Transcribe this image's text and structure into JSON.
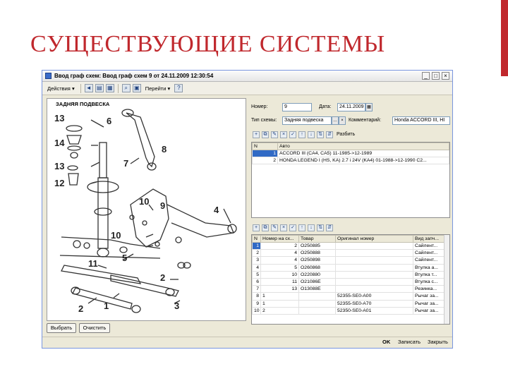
{
  "slide": {
    "title": "СУЩЕСТВУЮЩИЕ СИСТЕМЫ",
    "accent_color": "#c0282d"
  },
  "window": {
    "title": "Ввод граф схем: Ввод граф схем 9 от 24.11.2009 12:30:54",
    "toolbar": {
      "actions_menu": "Действия ▾",
      "goto_menu": "Перейти ▾",
      "help": "?"
    },
    "scheme": {
      "title": "ЗАДНЯЯ ПОДВЕСКА",
      "callouts": [
        "13",
        "6",
        "14",
        "8",
        "13",
        "7",
        "12",
        "9",
        "10",
        "4",
        "10",
        "5",
        "11",
        "2",
        "1",
        "2",
        "3"
      ]
    },
    "buttons": {
      "select": "Выбрать",
      "clear": "Очистить"
    },
    "form": {
      "number_label": "Номер:",
      "number_value": "9",
      "date_label": "Дата:",
      "date_value": "24.11.2009",
      "scheme_type_label": "Тип схемы:",
      "scheme_type_value": "Задняя подвеска",
      "comment_label": "Комментарий:",
      "comment_value": "Honda ACCORD III, HI"
    },
    "auto_toolbar_label": "Разбить",
    "auto_table": {
      "columns": [
        "N",
        "Авто"
      ],
      "rows": [
        [
          "1",
          "ACCORD III (CA4, CA5) 11-1985->12-1989"
        ],
        [
          "2",
          "HONDA LEGEND I (HS, KA) 2.7 i 24V (KA4) 01-1988->12-1990 C2..."
        ]
      ]
    },
    "parts_table": {
      "columns": [
        "N",
        "Номер на сх...",
        "Товар",
        "Оригинал номер",
        "Вид запч..."
      ],
      "rows": [
        [
          "1",
          "2",
          "О250885",
          "",
          "Сайлент..."
        ],
        [
          "2",
          "4",
          "О250888",
          "",
          "Сайлент..."
        ],
        [
          "3",
          "4",
          "О250898",
          "",
          "Сайлент..."
        ],
        [
          "4",
          "5",
          "О260868",
          "",
          "Втулка а..."
        ],
        [
          "5",
          "10",
          "О220880",
          "",
          "Втулка т..."
        ],
        [
          "6",
          "11",
          "О21086Е",
          "",
          "Втулка с..."
        ],
        [
          "7",
          "13",
          "О13088Е",
          "",
          "Резинка..."
        ],
        [
          "8",
          "1",
          "",
          "52355-SE0-A00",
          "Рычаг за..."
        ],
        [
          "9",
          "1",
          "",
          "52355-SE0-A70",
          "Рычаг за..."
        ],
        [
          "10",
          "2",
          "",
          "52350-SE0-A01",
          "Рычаг за..."
        ]
      ]
    },
    "status": {
      "ok": "OK",
      "save": "Записать",
      "close": "Закрыть"
    }
  }
}
